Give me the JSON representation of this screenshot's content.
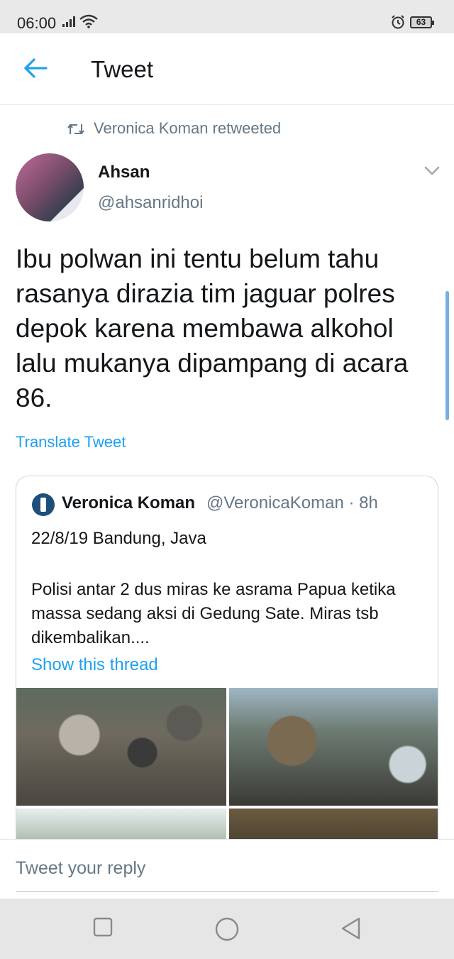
{
  "status_bar": {
    "time": "06:00",
    "battery": "63"
  },
  "app_bar": {
    "title": "Tweet",
    "back_icon": "arrow-left-icon"
  },
  "tweet": {
    "retweet_context": "Veronica Koman retweeted",
    "author_name": "Ahsan",
    "author_handle": "@ahsanridhoi",
    "text": "Ibu polwan ini tentu belum tahu rasanya dirazia tim jaguar polres depok karena membawa alkohol lalu mukanya dipampang di acara 86.",
    "translate_label": "Translate Tweet"
  },
  "quoted_tweet": {
    "name": "Veronica Koman",
    "handle_time": "@VeronicaKoman · 8h",
    "line1": "22/8/19 Bandung, Java",
    "line2": "Polisi antar 2 dus miras ke asrama Papua ketika massa sedang aksi di Gedung Sate. Miras tsb dikembalikan....",
    "show_thread": "Show this thread"
  },
  "reply": {
    "placeholder": "Tweet your reply"
  },
  "colors": {
    "accent": "#1da1f2",
    "secondary_text": "#657786",
    "border": "#ccd6dd"
  }
}
